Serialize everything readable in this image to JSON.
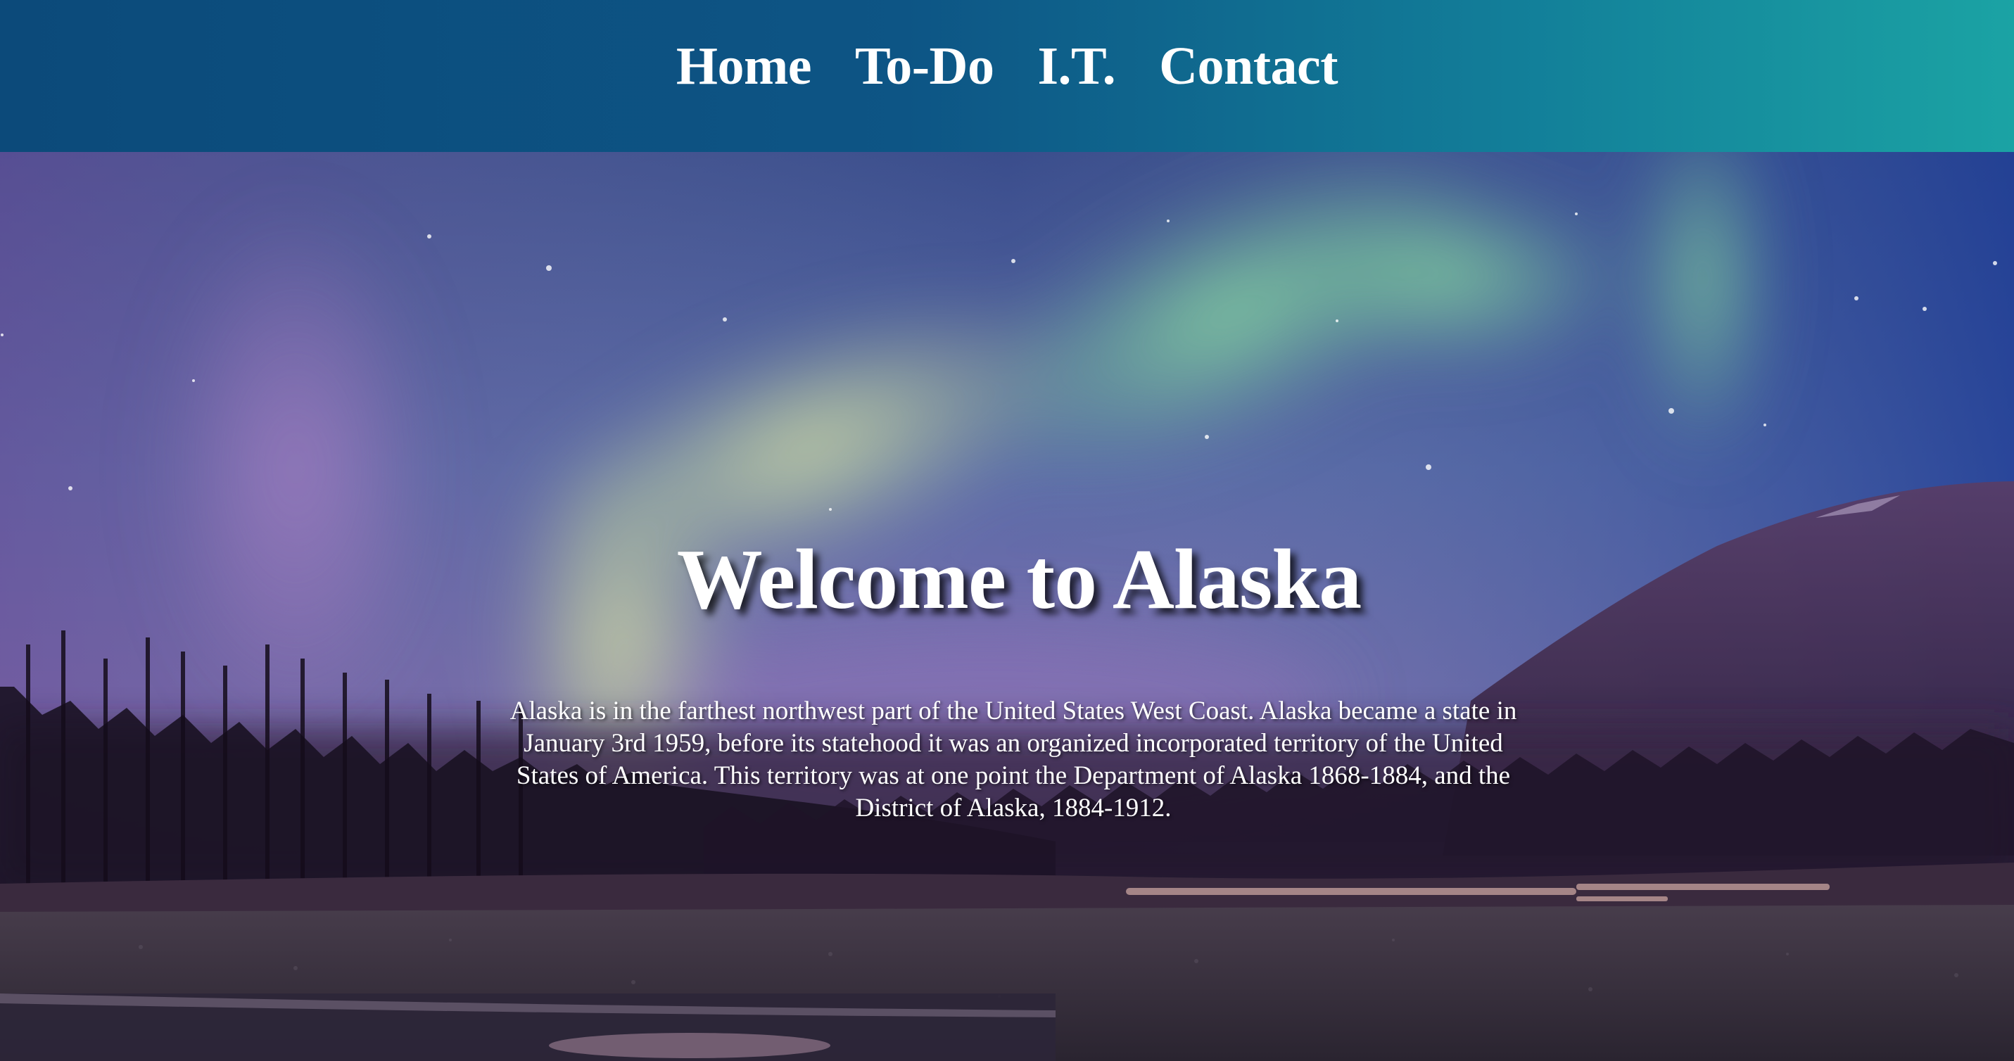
{
  "nav": {
    "items": [
      {
        "label": "Home"
      },
      {
        "label": "To-Do"
      },
      {
        "label": "I.T."
      },
      {
        "label": "Contact"
      }
    ]
  },
  "hero": {
    "title": "Welcome to Alaska",
    "description": "Alaska is in the farthest northwest part of the United States West Coast. Alaska became a state in January 3rd 1959, before its statehood it was an organized incorporated territory of the United States of America. This territory was at one point the Department of Alaska 1868-1884, and the District of Alaska, 1884-1912."
  },
  "colors": {
    "nav_gradient_start": "#0c4a7a",
    "nav_gradient_end": "#1ba3a4",
    "text": "#ffffff"
  }
}
